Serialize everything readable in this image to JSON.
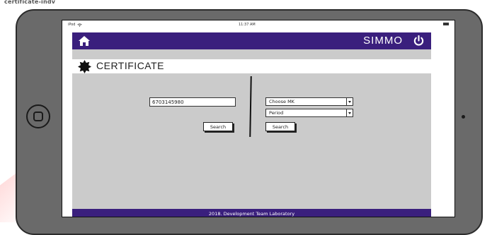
{
  "page": {
    "caption": "certificate-indv"
  },
  "device": {
    "status": {
      "carrier": "iPod",
      "time": "11:37 AM"
    }
  },
  "header": {
    "brand": "SIMMO"
  },
  "title": {
    "text": "CERTIFICATE"
  },
  "form_left": {
    "id_value": "6703145980",
    "search_label": "Search"
  },
  "form_right": {
    "mk_selected": "Choose MK",
    "period_selected": "Period",
    "search_label": "Search"
  },
  "footer": {
    "text": "2018. Development Team Laboratory"
  },
  "colors": {
    "header_bg": "#3a1f7d",
    "content_bg": "#cbcbcb",
    "tablet_body": "#6a6a6a"
  }
}
